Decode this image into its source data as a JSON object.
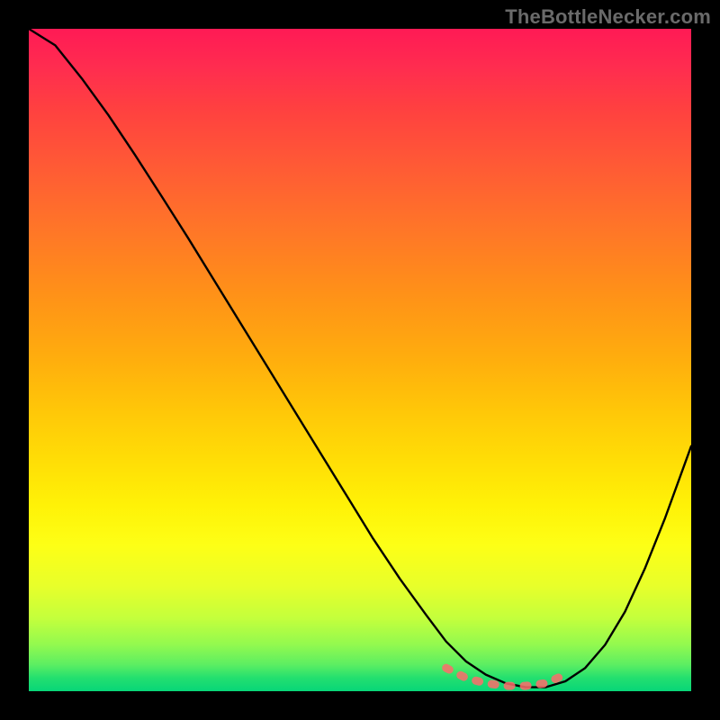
{
  "watermark": "TheBottleNecker.com",
  "chart_data": {
    "type": "line",
    "title": "",
    "xlabel": "",
    "ylabel": "",
    "xlim": [
      0,
      100
    ],
    "ylim": [
      0,
      100
    ],
    "grid": false,
    "legend": false,
    "background_gradient": {
      "direction": "vertical",
      "stops": [
        {
          "pos": 0.0,
          "color": "#ff1a55"
        },
        {
          "pos": 0.5,
          "color": "#ffae0d"
        },
        {
          "pos": 0.78,
          "color": "#fdff16"
        },
        {
          "pos": 1.0,
          "color": "#08d678"
        }
      ]
    },
    "series": [
      {
        "name": "bottleneck-curve",
        "color": "#000000",
        "x": [
          0,
          4,
          8,
          12,
          16,
          20,
          24,
          28,
          32,
          36,
          40,
          44,
          48,
          52,
          56,
          60,
          63,
          66,
          69,
          72,
          75,
          78,
          81,
          84,
          87,
          90,
          93,
          96,
          100
        ],
        "y": [
          100,
          97.5,
          92.5,
          87,
          81,
          74.8,
          68.5,
          62,
          55.5,
          49,
          42.5,
          36,
          29.5,
          23,
          17,
          11.5,
          7.5,
          4.5,
          2.5,
          1.2,
          0.6,
          0.6,
          1.5,
          3.5,
          7,
          12,
          18.5,
          26,
          37
        ]
      },
      {
        "name": "optimal-zone-marker",
        "color": "#ff6b6b",
        "style": "thick-dashed",
        "x": [
          63,
          66,
          69,
          72,
          75,
          78,
          81
        ],
        "y": [
          3.5,
          2.0,
          1.2,
          0.8,
          0.8,
          1.2,
          2.5
        ]
      }
    ],
    "annotations": []
  }
}
